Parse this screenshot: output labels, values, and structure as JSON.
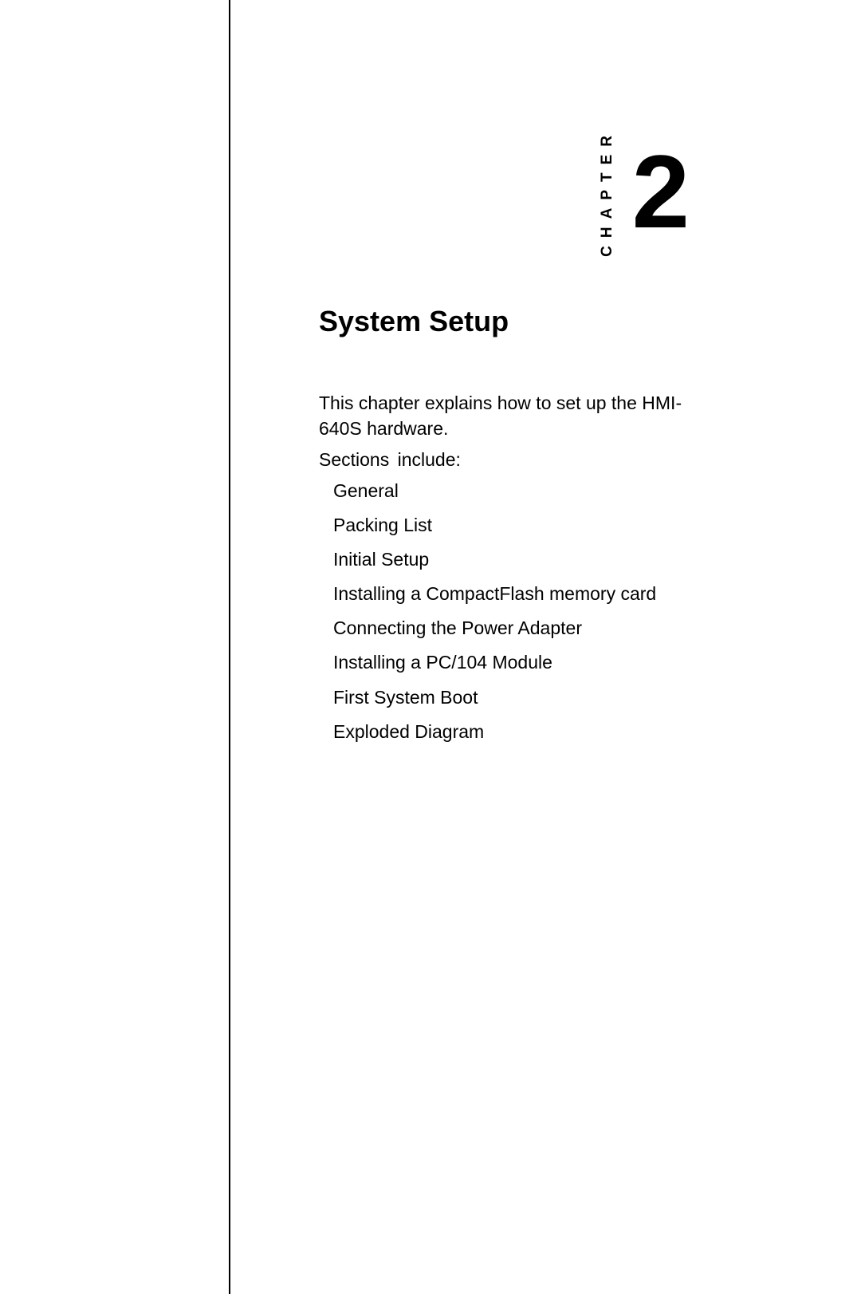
{
  "chapter": {
    "label": "CHAPTER",
    "number": "2"
  },
  "title": "System Setup",
  "intro": "This chapter explains how to set up the HMI-640S hardware.",
  "sections_label": "Sections include:",
  "sections": [
    "General",
    "Packing List",
    "Initial Setup",
    "Installing a CompactFlash memory card",
    "Connecting the Power Adapter",
    "Installing a PC/104 Module",
    "First System Boot",
    "Exploded Diagram"
  ]
}
